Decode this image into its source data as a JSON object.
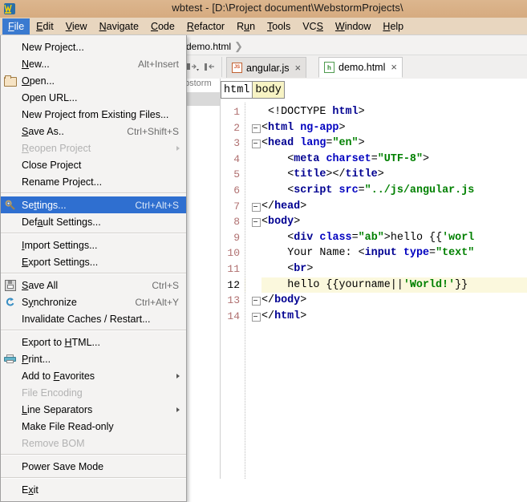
{
  "window": {
    "title": "wbtest - [D:\\Project document\\WebstormProjects\\",
    "app_icon": "webstorm-icon"
  },
  "menubar": {
    "items": [
      {
        "label": "File",
        "mnemonic": "F",
        "active": true
      },
      {
        "label": "Edit",
        "mnemonic": "E",
        "active": false
      },
      {
        "label": "View",
        "mnemonic": "V",
        "active": false
      },
      {
        "label": "Navigate",
        "mnemonic": "N",
        "active": false
      },
      {
        "label": "Code",
        "mnemonic": "C",
        "active": false
      },
      {
        "label": "Refactor",
        "mnemonic": "R",
        "active": false
      },
      {
        "label": "Run",
        "mnemonic": "u",
        "active": false
      },
      {
        "label": "Tools",
        "mnemonic": "T",
        "active": false
      },
      {
        "label": "VCS",
        "mnemonic": "S",
        "active": false
      },
      {
        "label": "Window",
        "mnemonic": "W",
        "active": false
      },
      {
        "label": "Help",
        "mnemonic": "H",
        "active": false
      }
    ]
  },
  "file_menu": {
    "items": [
      {
        "label": "New Project...",
        "shortcut": "",
        "icon": "",
        "disabled": false,
        "selected": false,
        "submenu": false
      },
      {
        "label": "New...",
        "shortcut": "Alt+Insert",
        "icon": "",
        "disabled": false,
        "selected": false,
        "submenu": false
      },
      {
        "label": "Open...",
        "shortcut": "",
        "icon": "folder-icon",
        "disabled": false,
        "selected": false,
        "submenu": false
      },
      {
        "label": "Open URL...",
        "shortcut": "",
        "icon": "",
        "disabled": false,
        "selected": false,
        "submenu": false
      },
      {
        "label": "New Project from Existing Files...",
        "shortcut": "",
        "icon": "",
        "disabled": false,
        "selected": false,
        "submenu": false
      },
      {
        "label": "Save As..",
        "shortcut": "Ctrl+Shift+S",
        "icon": "",
        "disabled": false,
        "selected": false,
        "submenu": false
      },
      {
        "label": "Reopen Project",
        "shortcut": "",
        "icon": "",
        "disabled": true,
        "selected": false,
        "submenu": true
      },
      {
        "label": "Close Project",
        "shortcut": "",
        "icon": "",
        "disabled": false,
        "selected": false,
        "submenu": false
      },
      {
        "label": "Rename Project...",
        "shortcut": "",
        "icon": "",
        "disabled": false,
        "selected": false,
        "submenu": false
      },
      {
        "separator": true
      },
      {
        "label": "Settings...",
        "shortcut": "Ctrl+Alt+S",
        "icon": "gear-icon",
        "disabled": false,
        "selected": true,
        "submenu": false
      },
      {
        "label": "Default Settings...",
        "shortcut": "",
        "icon": "",
        "disabled": false,
        "selected": false,
        "submenu": false
      },
      {
        "separator": true
      },
      {
        "label": "Import Settings...",
        "shortcut": "",
        "icon": "",
        "disabled": false,
        "selected": false,
        "submenu": false
      },
      {
        "label": "Export Settings...",
        "shortcut": "",
        "icon": "",
        "disabled": false,
        "selected": false,
        "submenu": false
      },
      {
        "separator": true
      },
      {
        "label": "Save All",
        "shortcut": "Ctrl+S",
        "icon": "save-icon",
        "disabled": false,
        "selected": false,
        "submenu": false
      },
      {
        "label": "Synchronize",
        "shortcut": "Ctrl+Alt+Y",
        "icon": "sync-icon",
        "disabled": false,
        "selected": false,
        "submenu": false
      },
      {
        "label": "Invalidate Caches / Restart...",
        "shortcut": "",
        "icon": "",
        "disabled": false,
        "selected": false,
        "submenu": false
      },
      {
        "separator": true
      },
      {
        "label": "Export to HTML...",
        "shortcut": "",
        "icon": "",
        "disabled": false,
        "selected": false,
        "submenu": false
      },
      {
        "label": "Print...",
        "shortcut": "",
        "icon": "print-icon",
        "disabled": false,
        "selected": false,
        "submenu": false
      },
      {
        "label": "Add to Favorites",
        "shortcut": "",
        "icon": "",
        "disabled": false,
        "selected": false,
        "submenu": true
      },
      {
        "label": "File Encoding",
        "shortcut": "",
        "icon": "",
        "disabled": true,
        "selected": false,
        "submenu": false
      },
      {
        "label": "Line Separators",
        "shortcut": "",
        "icon": "",
        "disabled": false,
        "selected": false,
        "submenu": true
      },
      {
        "label": "Make File Read-only",
        "shortcut": "",
        "icon": "",
        "disabled": false,
        "selected": false,
        "submenu": false
      },
      {
        "label": "Remove BOM",
        "shortcut": "",
        "icon": "",
        "disabled": true,
        "selected": false,
        "submenu": false
      },
      {
        "separator": true
      },
      {
        "label": "Power Save Mode",
        "shortcut": "",
        "icon": "",
        "disabled": false,
        "selected": false,
        "submenu": false
      },
      {
        "separator": true
      },
      {
        "label": "Exit",
        "shortcut": "",
        "icon": "",
        "disabled": false,
        "selected": false,
        "submenu": false
      }
    ]
  },
  "navbar": {
    "path_tail": "demo.html"
  },
  "project_panel": {
    "clipped_label": "bstorm"
  },
  "tabs": [
    {
      "label": "angular.js",
      "icon": "js-file-icon",
      "active": false,
      "close": "×"
    },
    {
      "label": "demo.html",
      "icon": "html-file-icon",
      "active": true,
      "close": "×"
    }
  ],
  "editor": {
    "breadcrumbs": [
      {
        "label": "html",
        "highlighted": false
      },
      {
        "label": "body",
        "highlighted": true
      }
    ],
    "current_line": 12,
    "lines": [
      {
        "n": 1,
        "indent": 1,
        "fold": false,
        "tokens": [
          {
            "t": "<!DOCTYPE ",
            "c": "punc"
          },
          {
            "t": "html",
            "c": "tag"
          },
          {
            "t": ">",
            "c": "punc"
          }
        ]
      },
      {
        "n": 2,
        "indent": 0,
        "fold": true,
        "tokens": [
          {
            "t": "<",
            "c": "punc"
          },
          {
            "t": "html",
            "c": "tag"
          },
          {
            "t": " ",
            "c": "punc"
          },
          {
            "t": "ng-app",
            "c": "attr"
          },
          {
            "t": ">",
            "c": "punc"
          }
        ]
      },
      {
        "n": 3,
        "indent": 0,
        "fold": true,
        "tokens": [
          {
            "t": "<",
            "c": "punc"
          },
          {
            "t": "head",
            "c": "tag"
          },
          {
            "t": " ",
            "c": "punc"
          },
          {
            "t": "lang",
            "c": "attr"
          },
          {
            "t": "=",
            "c": "punc"
          },
          {
            "t": "\"en\"",
            "c": "val"
          },
          {
            "t": ">",
            "c": "punc"
          }
        ]
      },
      {
        "n": 4,
        "indent": 4,
        "fold": false,
        "tokens": [
          {
            "t": "<",
            "c": "punc"
          },
          {
            "t": "meta",
            "c": "tag"
          },
          {
            "t": " ",
            "c": "punc"
          },
          {
            "t": "charset",
            "c": "attr"
          },
          {
            "t": "=",
            "c": "punc"
          },
          {
            "t": "\"UTF-8\"",
            "c": "val"
          },
          {
            "t": ">",
            "c": "punc"
          }
        ]
      },
      {
        "n": 5,
        "indent": 4,
        "fold": false,
        "tokens": [
          {
            "t": "<",
            "c": "punc"
          },
          {
            "t": "title",
            "c": "tag"
          },
          {
            "t": "></",
            "c": "punc"
          },
          {
            "t": "title",
            "c": "tag"
          },
          {
            "t": ">",
            "c": "punc"
          }
        ]
      },
      {
        "n": 6,
        "indent": 4,
        "fold": false,
        "tokens": [
          {
            "t": "<",
            "c": "punc"
          },
          {
            "t": "script",
            "c": "tag"
          },
          {
            "t": " ",
            "c": "punc"
          },
          {
            "t": "src",
            "c": "attr"
          },
          {
            "t": "=",
            "c": "punc"
          },
          {
            "t": "\"../js/angular.js",
            "c": "val"
          }
        ]
      },
      {
        "n": 7,
        "indent": 0,
        "fold": true,
        "tokens": [
          {
            "t": "</",
            "c": "punc"
          },
          {
            "t": "head",
            "c": "tag"
          },
          {
            "t": ">",
            "c": "punc"
          }
        ]
      },
      {
        "n": 8,
        "indent": 0,
        "fold": true,
        "tokens": [
          {
            "t": "<",
            "c": "punc"
          },
          {
            "t": "body",
            "c": "tag"
          },
          {
            "t": ">",
            "c": "punc"
          }
        ]
      },
      {
        "n": 9,
        "indent": 4,
        "fold": false,
        "tokens": [
          {
            "t": "<",
            "c": "punc"
          },
          {
            "t": "div",
            "c": "tag"
          },
          {
            "t": " ",
            "c": "punc"
          },
          {
            "t": "class",
            "c": "attr"
          },
          {
            "t": "=",
            "c": "punc"
          },
          {
            "t": "\"ab\"",
            "c": "val"
          },
          {
            "t": ">hello {{",
            "c": "txt"
          },
          {
            "t": "'worl",
            "c": "val"
          }
        ]
      },
      {
        "n": 10,
        "indent": 4,
        "fold": false,
        "tokens": [
          {
            "t": "Your Name: ",
            "c": "txt"
          },
          {
            "t": "<",
            "c": "punc"
          },
          {
            "t": "input",
            "c": "tag"
          },
          {
            "t": " ",
            "c": "punc"
          },
          {
            "t": "type",
            "c": "attr"
          },
          {
            "t": "=",
            "c": "punc"
          },
          {
            "t": "\"text\"",
            "c": "val"
          }
        ]
      },
      {
        "n": 11,
        "indent": 4,
        "fold": false,
        "tokens": [
          {
            "t": "<",
            "c": "punc"
          },
          {
            "t": "br",
            "c": "tag"
          },
          {
            "t": ">",
            "c": "punc"
          }
        ]
      },
      {
        "n": 12,
        "indent": 4,
        "fold": false,
        "tokens": [
          {
            "t": "hello {{yourname||",
            "c": "txt"
          },
          {
            "t": "'World!'",
            "c": "val"
          },
          {
            "t": "}}",
            "c": "txt"
          }
        ]
      },
      {
        "n": 13,
        "indent": 0,
        "fold": true,
        "tokens": [
          {
            "t": "</",
            "c": "punc"
          },
          {
            "t": "body",
            "c": "tag"
          },
          {
            "t": ">",
            "c": "punc"
          }
        ]
      },
      {
        "n": 14,
        "indent": 0,
        "fold": true,
        "tokens": [
          {
            "t": "</",
            "c": "punc"
          },
          {
            "t": "html",
            "c": "tag"
          },
          {
            "t": ">",
            "c": "punc"
          }
        ]
      }
    ]
  },
  "colors": {
    "titlebar": "#d9b48f",
    "menubar": "#e8d6bf",
    "menu_selected": "#2f6fd0",
    "menubar_active": "#3a7ad0",
    "tag": "#000091",
    "attribute": "#0000c0",
    "string": "#008000",
    "line_number": "#b07070",
    "current_line_bg": "#fbf8dd"
  }
}
